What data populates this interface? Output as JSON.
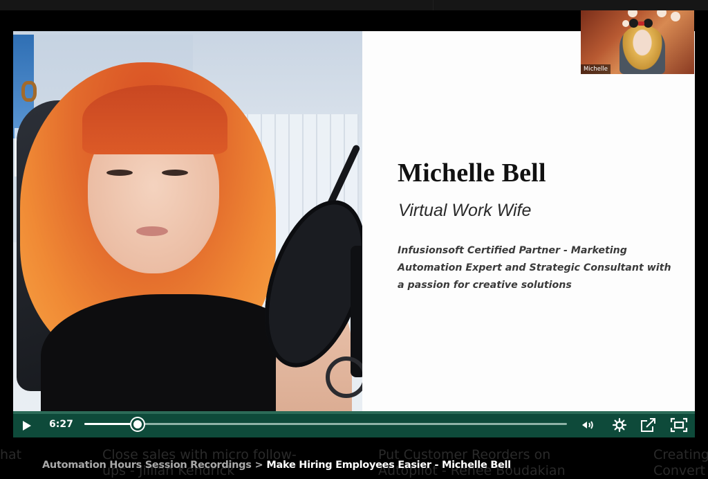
{
  "video": {
    "slide": {
      "name": "Michelle Bell",
      "subtitle": "Virtual Work Wife",
      "bio": "Infusionsoft Certified Partner - Marketing Automation Expert and Strategic Consultant with a passion for creative solutions"
    },
    "pip": {
      "participant_label": "Michelle"
    }
  },
  "player": {
    "current_time": "6:27",
    "progress_percent": 11,
    "play_icon": "play-icon",
    "volume_icon": "volume-icon",
    "settings_icon": "gear-icon",
    "share_icon": "share-icon",
    "fullscreen_icon": "fullscreen-icon",
    "accent_color": "#0e4a3a"
  },
  "breadcrumb": {
    "parent": "Automation Hours Session Recordings",
    "separator": ">",
    "current": "Make Hiring Employees Easier - Michelle Bell"
  },
  "background_cards": [
    {
      "line1": "hat",
      "line2": ""
    },
    {
      "line1": "Close sales with micro follow-",
      "line2": "ups - Jillian Kendrick"
    },
    {
      "line1": "Put Customer Reorders on",
      "line2": "Autopilot - Renée Boudakian"
    },
    {
      "line1": "Creating",
      "line2": "Convert"
    }
  ]
}
